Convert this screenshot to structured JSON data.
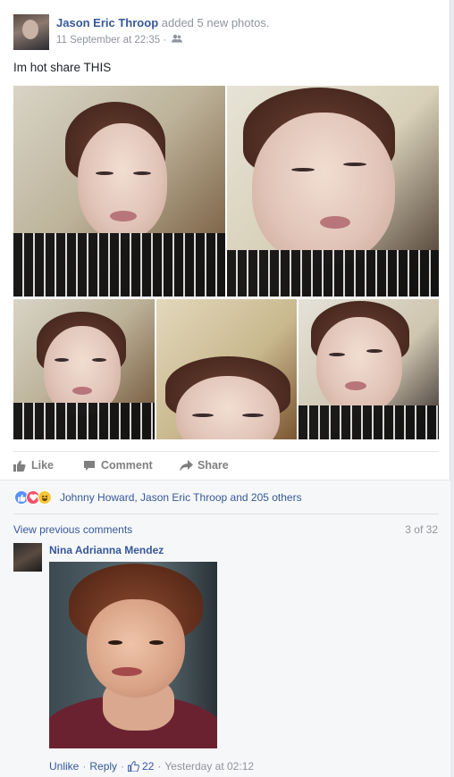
{
  "post": {
    "author": "Jason Eric Throop",
    "action": "added 5 new photos.",
    "timestamp": "11 September at 22:35",
    "audience_icon": "friends-icon",
    "status_text": "Im hot share THIS",
    "photos": [
      {
        "alt": "selfie-1"
      },
      {
        "alt": "selfie-2"
      },
      {
        "alt": "selfie-3"
      },
      {
        "alt": "selfie-4"
      },
      {
        "alt": "selfie-5"
      }
    ]
  },
  "actions": {
    "like": "Like",
    "comment": "Comment",
    "share": "Share"
  },
  "reactions": {
    "icons": [
      "like-reaction-icon",
      "love-reaction-icon",
      "haha-reaction-icon"
    ],
    "summary": "Johnny Howard, Jason Eric Throop and 205 others"
  },
  "comments": {
    "view_previous": "View previous comments",
    "count": "3 of 32",
    "items": [
      {
        "author": "Nina Adrianna Mendez",
        "unlike": "Unlike",
        "reply": "Reply",
        "likes": "22",
        "time": "Yesterday at 02:12"
      }
    ]
  },
  "colors": {
    "link": "#365899",
    "muted": "#90949c",
    "like_blue": "#5890ff",
    "love_red": "#f25268",
    "haha_yellow": "#f7c63b"
  }
}
